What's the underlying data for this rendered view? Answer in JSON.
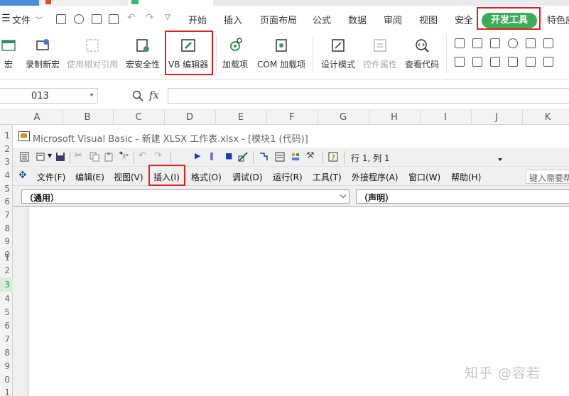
{
  "app": {
    "menu": [
      "文件",
      "开始",
      "插入",
      "页面布局",
      "公式",
      "数据",
      "审阅",
      "视图",
      "安全",
      "开发工具",
      "特色应"
    ]
  },
  "ribbon": {
    "buttons": [
      {
        "label": "宏",
        "icon": "macro-icon"
      },
      {
        "label": "录制新宏",
        "icon": "record-macro-icon"
      },
      {
        "label": "使用相对引用",
        "icon": "relative-ref-icon",
        "disabled": true
      },
      {
        "label": "宏安全性",
        "icon": "macro-security-icon"
      },
      {
        "label": "VB 编辑器",
        "icon": "vb-editor-icon"
      },
      {
        "label": "加载项",
        "icon": "addin-gear-icon"
      },
      {
        "label": "COM 加载项",
        "icon": "com-addin-icon"
      },
      {
        "label": "设计模式",
        "icon": "design-mode-icon"
      },
      {
        "label": "控件属性",
        "icon": "control-props-icon",
        "disabled": true
      },
      {
        "label": "查看代码",
        "icon": "view-code-icon"
      }
    ]
  },
  "formula_bar": {
    "name_box": "013",
    "fx": "fx"
  },
  "sheet": {
    "columns": [
      "A",
      "B",
      "C",
      "D",
      "E",
      "F",
      "G",
      "H",
      "I",
      "J",
      "K"
    ],
    "rows": [
      "1",
      "2",
      "3",
      "4",
      "5",
      "6",
      "7",
      "8",
      "9",
      "0",
      "1",
      "2",
      "3",
      "4",
      "5",
      "6",
      "7",
      "8",
      "9",
      "0",
      "1"
    ],
    "selected_row_index": 12
  },
  "vbe": {
    "title": "Microsoft Visual Basic - 新建 XLSX 工作表.xlsx - [模块1 (代码)]",
    "position": "行 1, 列 1",
    "menu": [
      "文件(F)",
      "编辑(E)",
      "视图(V)",
      "插入(I)",
      "格式(O)",
      "调试(D)",
      "运行(R)",
      "工具(T)",
      "外接程序(A)",
      "窗口(W)",
      "帮助(H)"
    ],
    "help_hint": "键入需要帮",
    "object_combo": "（通用）",
    "proc_combo": "（声明）"
  },
  "watermark": "知乎 @容若",
  "colors": {
    "dev_tab": "#3dab5a",
    "highlight": "#e02020",
    "selected_row": "#d7ecd9"
  }
}
